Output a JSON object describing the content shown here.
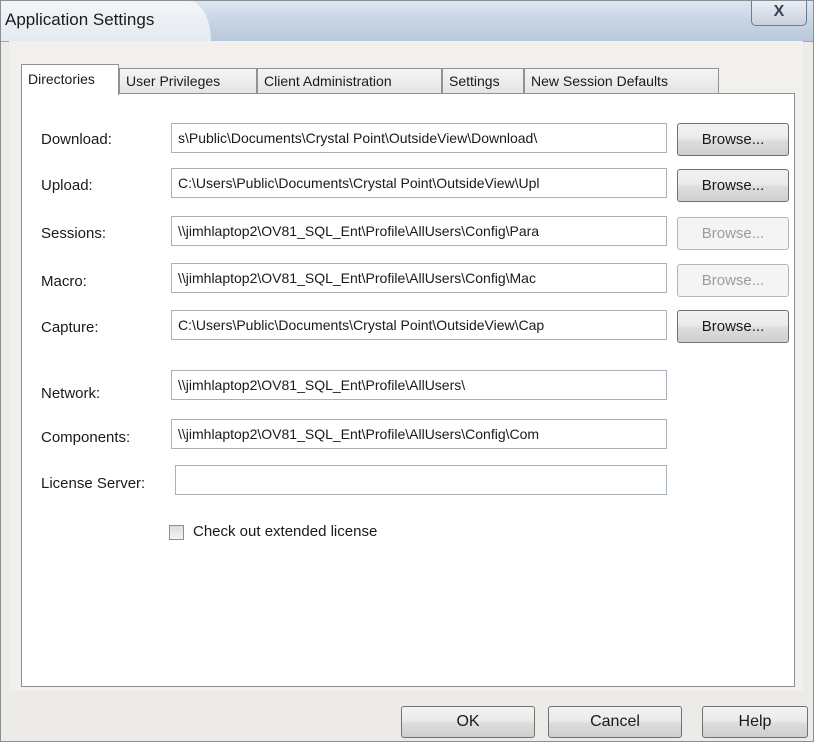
{
  "window": {
    "title": "Application Settings",
    "close_glyph": "X"
  },
  "tabs": [
    {
      "label": "Directories",
      "active": true
    },
    {
      "label": "User Privileges",
      "active": false
    },
    {
      "label": "Client Administration",
      "active": false
    },
    {
      "label": "Settings",
      "active": false
    },
    {
      "label": "New Session Defaults",
      "active": false
    }
  ],
  "directories": {
    "download": {
      "label": "Download:",
      "value": "s\\Public\\Documents\\Crystal Point\\OutsideView\\Download\\",
      "browse": "Browse...",
      "browse_enabled": true
    },
    "upload": {
      "label": "Upload:",
      "value": "C:\\Users\\Public\\Documents\\Crystal Point\\OutsideView\\Upl",
      "browse": "Browse...",
      "browse_enabled": true
    },
    "sessions": {
      "label": "Sessions:",
      "value": "\\\\jimhlaptop2\\OV81_SQL_Ent\\Profile\\AllUsers\\Config\\Para",
      "browse": "Browse...",
      "browse_enabled": false
    },
    "macro": {
      "label": "Macro:",
      "value": "\\\\jimhlaptop2\\OV81_SQL_Ent\\Profile\\AllUsers\\Config\\Mac",
      "browse": "Browse...",
      "browse_enabled": false
    },
    "capture": {
      "label": "Capture:",
      "value": "C:\\Users\\Public\\Documents\\Crystal Point\\OutsideView\\Cap",
      "browse": "Browse...",
      "browse_enabled": true
    },
    "network": {
      "label": "Network:",
      "value": "\\\\jimhlaptop2\\OV81_SQL_Ent\\Profile\\AllUsers\\"
    },
    "components": {
      "label": "Components:",
      "value": "\\\\jimhlaptop2\\OV81_SQL_Ent\\Profile\\AllUsers\\Config\\Com"
    },
    "license_server": {
      "label": "License Server:",
      "value": ""
    }
  },
  "extended_license": {
    "label": "Check out extended license",
    "checked": false
  },
  "footer": {
    "ok": "OK",
    "cancel": "Cancel",
    "help": "Help"
  }
}
